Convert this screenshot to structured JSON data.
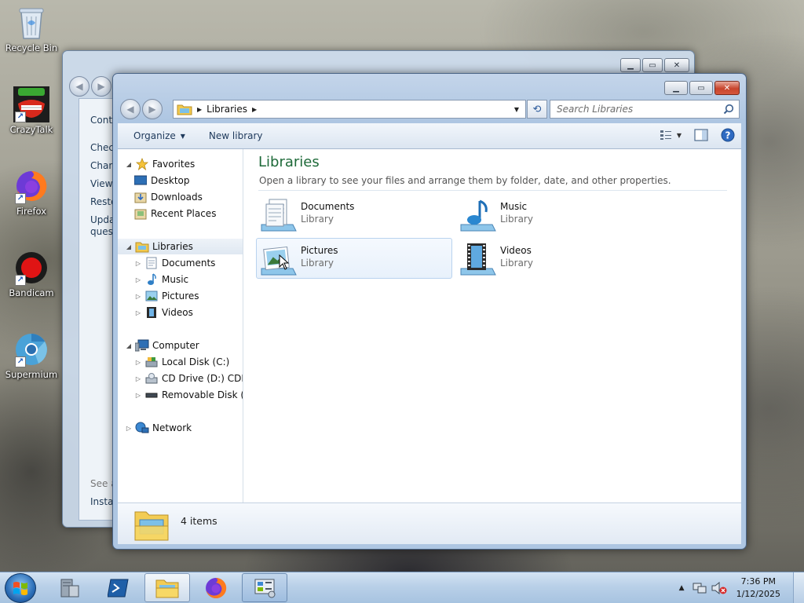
{
  "desktop": {
    "icons": [
      {
        "label": "Recycle Bin"
      },
      {
        "label": "CrazyTalk"
      },
      {
        "label": "Firefox"
      },
      {
        "label": "Bandicam"
      },
      {
        "label": "Supermium"
      }
    ]
  },
  "back_window": {
    "lines": [
      "Contr",
      "Chec",
      "Chan",
      "View",
      "Resto",
      "Upda",
      "quest",
      "See a",
      "Instal"
    ]
  },
  "explorer": {
    "address": {
      "crumbs": [
        "Libraries"
      ]
    },
    "search_placeholder": "Search Libraries",
    "toolbar": {
      "organize": "Organize",
      "new_library": "New library"
    },
    "nav": {
      "favorites": "Favorites",
      "favorites_items": [
        "Desktop",
        "Downloads",
        "Recent Places"
      ],
      "libraries": "Libraries",
      "libraries_items": [
        "Documents",
        "Music",
        "Pictures",
        "Videos"
      ],
      "computer": "Computer",
      "computer_items": [
        "Local Disk (C:)",
        "CD Drive (D:) CDROM",
        "Removable Disk (E:)"
      ],
      "network": "Network"
    },
    "content": {
      "title": "Libraries",
      "subtitle": "Open a library to see your files and arrange them by folder, date, and other properties.",
      "libraries": [
        {
          "name": "Documents",
          "type": "Library"
        },
        {
          "name": "Music",
          "type": "Library"
        },
        {
          "name": "Pictures",
          "type": "Library"
        },
        {
          "name": "Videos",
          "type": "Library"
        }
      ]
    },
    "details": {
      "count": "4 items"
    }
  },
  "taskbar": {
    "clock": {
      "time": "7:36 PM",
      "date": "1/12/2025"
    }
  },
  "colors": {
    "title_green": "#1e6a39",
    "selection_blue": "#e8f1fb",
    "close_red": "#c8452d"
  }
}
